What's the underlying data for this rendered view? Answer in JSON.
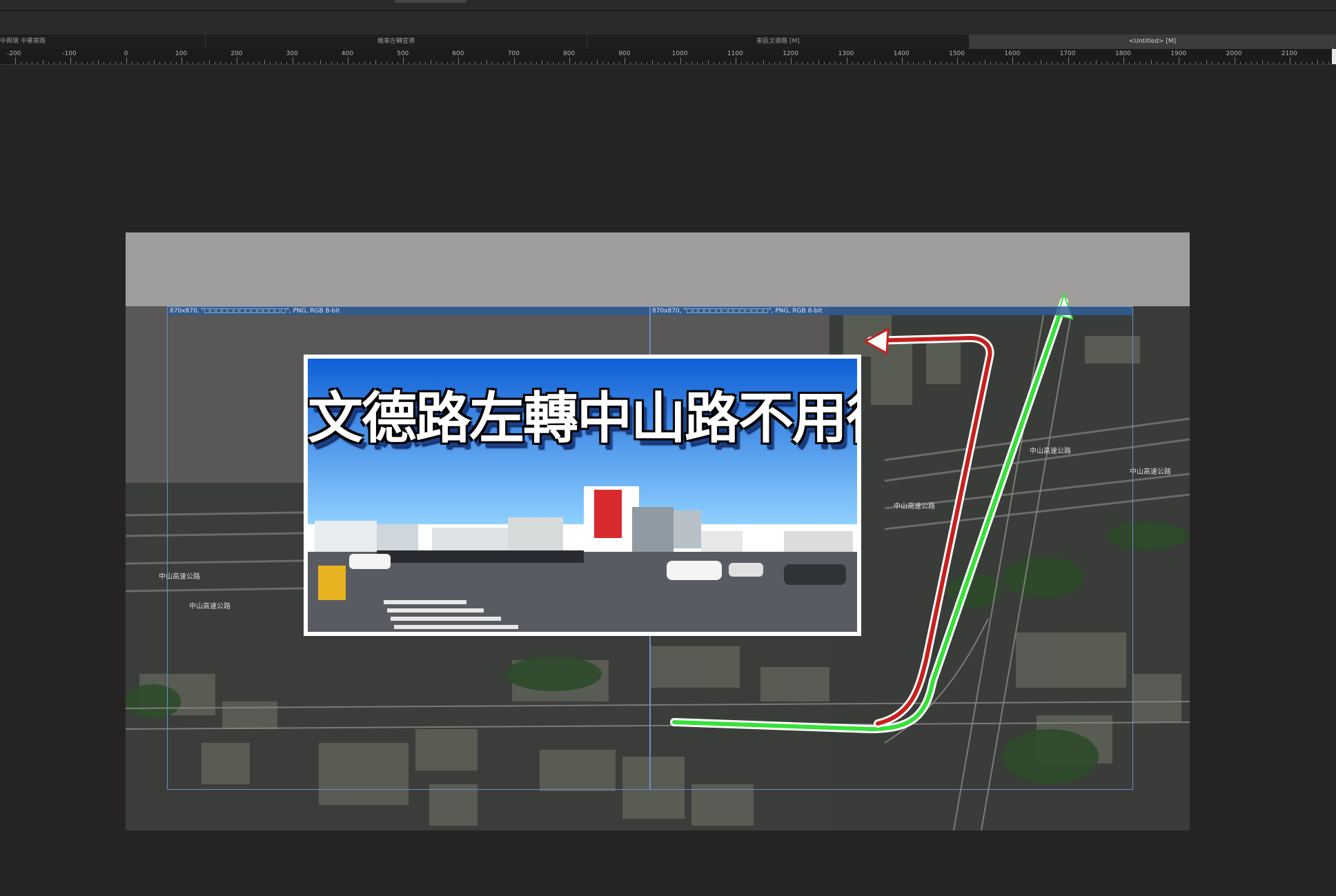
{
  "tabs": [
    {
      "label": "中興環 中華東路",
      "active": false
    },
    {
      "label": "機車左轉宣導",
      "active": false
    },
    {
      "label": "東區文德路 [M]",
      "active": false
    },
    {
      "label": "<Untitled> [M]",
      "active": true
    }
  ],
  "ruler": {
    "labels": [
      "-200",
      "-100",
      "0",
      "100",
      "200",
      "300",
      "400",
      "500",
      "600",
      "700",
      "800",
      "900",
      "1000",
      "1100",
      "1200",
      "1300",
      "1400",
      "1500",
      "1600",
      "1700",
      "1800",
      "1900",
      "2000",
      "2100"
    ]
  },
  "layers": {
    "left_info": "870x870, \"□□□□□□□□□□□□□□\", PNG, RGB 8-bit",
    "right_info": "870x870, \"□□□□□□□□□□□□□□\", PNG, RGB 8-bit"
  },
  "thumbnail": {
    "title": "文德路左轉中山路不用待轉"
  },
  "map_labels": [
    "中山高速公路",
    "中山高速公路",
    "中山高速公路",
    "中山高速公路",
    "中山高速公路"
  ],
  "colors": {
    "route_green": "#37e03a",
    "route_red": "#c8201e",
    "selection": "#6c8fc7",
    "layer_bar": "#2f5c93"
  }
}
